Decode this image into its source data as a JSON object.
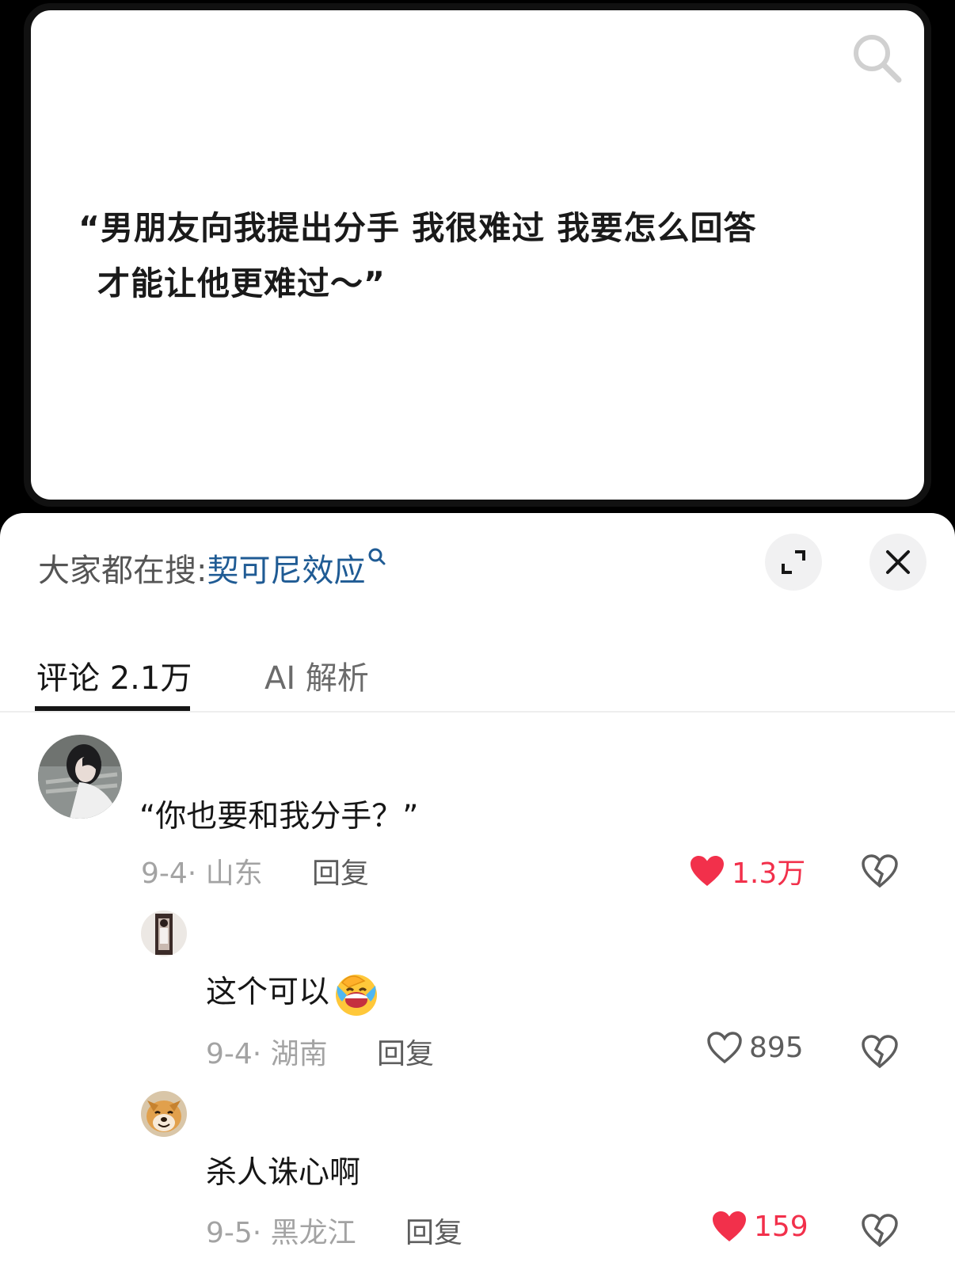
{
  "card": {
    "quote_line1": "“男朋友向我提出分手 我很难过 我要怎么回答",
    "quote_line2": "才能让他更难过～”",
    "search_icon": "search-icon"
  },
  "search_hint": {
    "prefix": "大家都在搜:",
    "keyword": "契可尼效应"
  },
  "buttons": {
    "expand_icon": "expand-icon",
    "close_icon": "close-icon"
  },
  "tabs": [
    {
      "label": "评论 2.1万",
      "active": true
    },
    {
      "label": "AI 解析",
      "active": false
    }
  ],
  "comments": [
    {
      "text": "“你也要和我分手？”",
      "date_location": "9-4· 山东",
      "reply_label": "回复",
      "likes": "1.3万",
      "liked": true
    },
    {
      "text": "这个可以",
      "emoji": "laughing-crying-emoji",
      "date_location": "9-4· 湖南",
      "reply_label": "回复",
      "likes": "895",
      "liked": false
    },
    {
      "text": "杀人诛心啊",
      "date_location": "9-5· 黑龙江",
      "reply_label": "回复",
      "likes": "159",
      "liked": true
    }
  ],
  "colors": {
    "like_active": "#f2304b",
    "keyword_blue": "#1f5b94"
  }
}
